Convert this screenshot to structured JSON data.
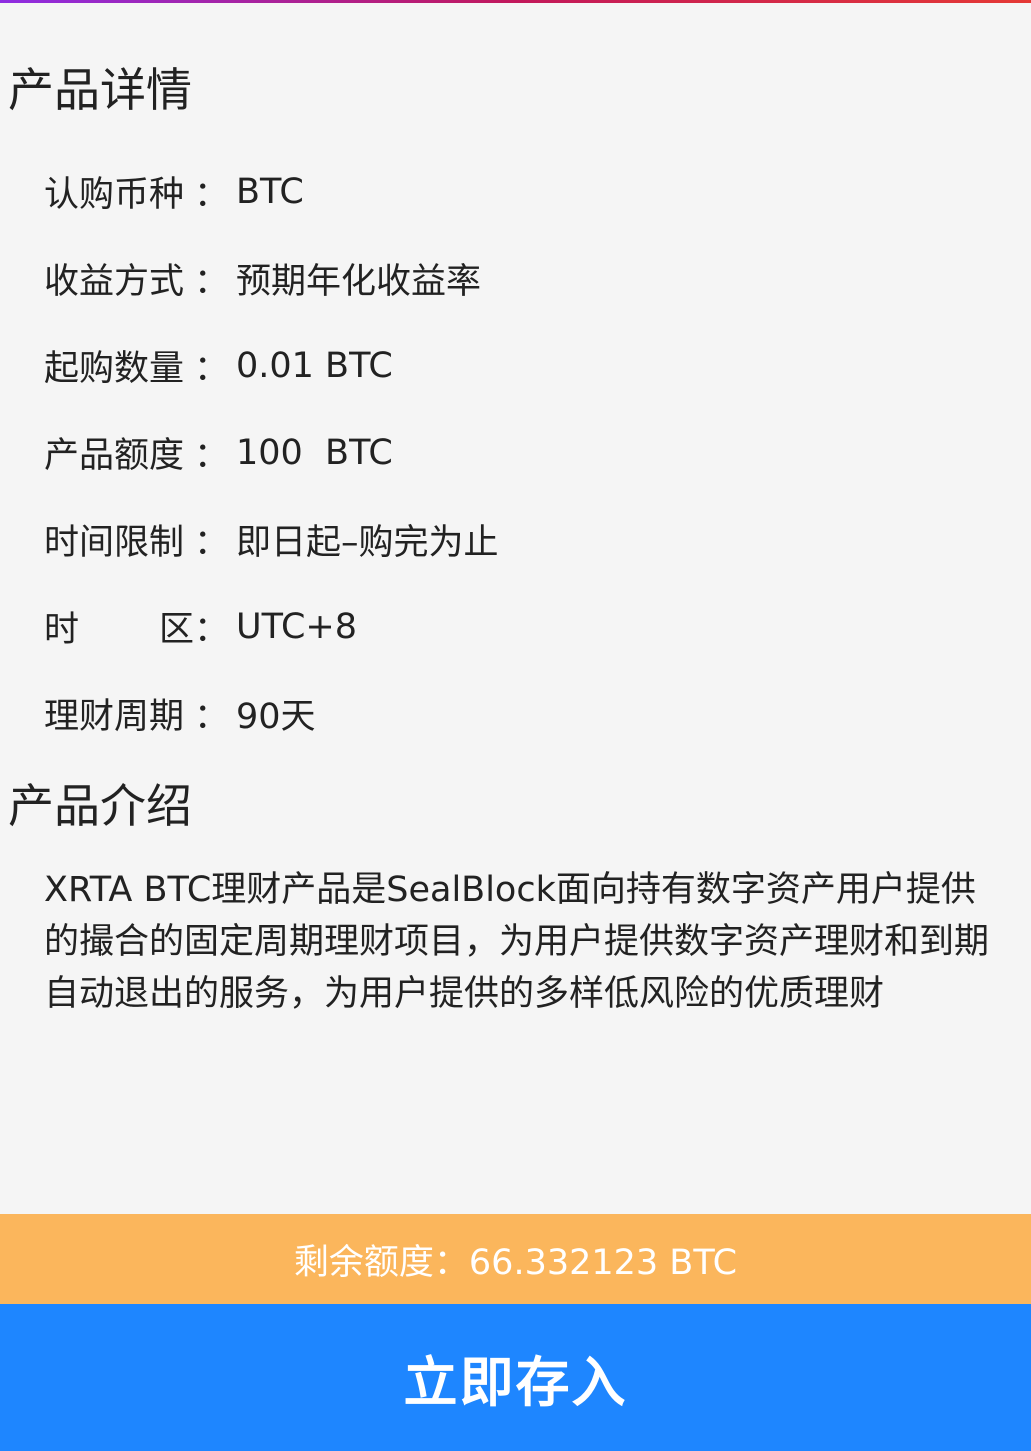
{
  "details": {
    "title": "产品详情",
    "rows": [
      {
        "label": "认购币种",
        "value": "BTC"
      },
      {
        "label": "收益方式",
        "value": "预期年化收益率"
      },
      {
        "label": "起购数量",
        "value": "0.01 BTC"
      },
      {
        "label": "产品额度",
        "value": "100  BTC"
      },
      {
        "label": "时间限制",
        "value": "即日起–购完为止"
      },
      {
        "label_first": "时",
        "label_last": "区",
        "value": "UTC+8"
      },
      {
        "label": "理财周期",
        "value": "90天"
      }
    ],
    "colon": "："
  },
  "intro": {
    "title": "产品介绍",
    "text": "XRTA BTC理财产品是SealBlock面向持有数字资产用户提供的撮合的固定周期理财项目，为用户提供数字资产理财和到期自动退出的服务，为用户提供的多样低风险的优质理财"
  },
  "remaining": {
    "text": "剩余额度：66.332123 BTC"
  },
  "action": {
    "deposit_label": "立即存入"
  },
  "colors": {
    "remaining_bar": "#fbb65c",
    "deposit_button": "#1e86ff",
    "background": "#f5f5f5"
  }
}
